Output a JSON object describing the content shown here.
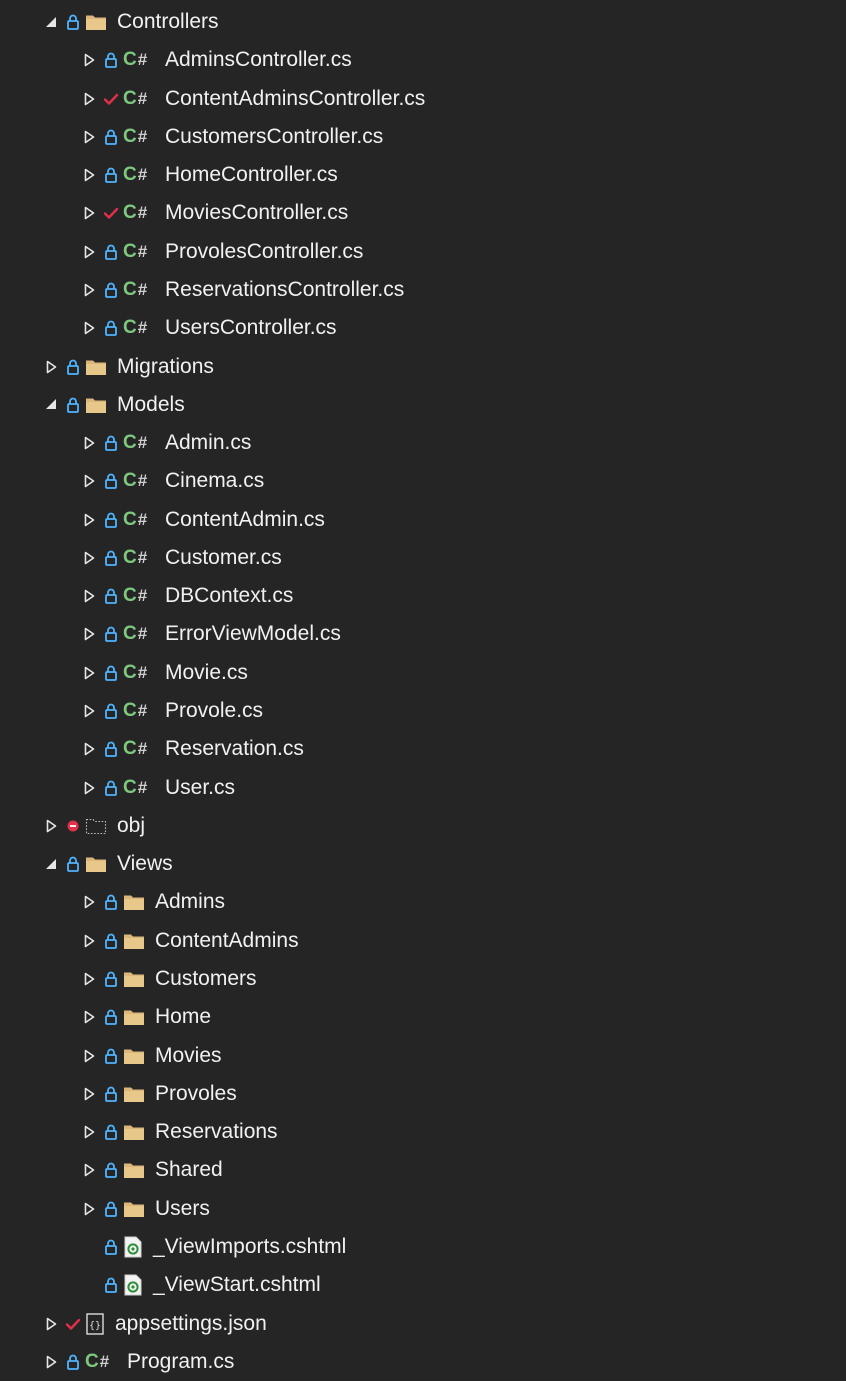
{
  "panel": "Solution Explorer",
  "colors": {
    "background": "#252526",
    "text": "#f1f1f1",
    "lock": "#4fb4ff",
    "check": "#e0304a",
    "error": "#e0304a",
    "folder": "#dcb67a",
    "csharp": "#7ec87e",
    "cshtml": "#7ec87e"
  },
  "tree": [
    {
      "label": "Controllers",
      "depth": 0,
      "expander": "expanded",
      "status": "lock",
      "type": "folder"
    },
    {
      "label": "AdminsController.cs",
      "depth": 1,
      "expander": "collapsed",
      "status": "lock",
      "type": "csharp"
    },
    {
      "label": "ContentAdminsController.cs",
      "depth": 1,
      "expander": "collapsed",
      "status": "check",
      "type": "csharp"
    },
    {
      "label": "CustomersController.cs",
      "depth": 1,
      "expander": "collapsed",
      "status": "lock",
      "type": "csharp"
    },
    {
      "label": "HomeController.cs",
      "depth": 1,
      "expander": "collapsed",
      "status": "lock",
      "type": "csharp"
    },
    {
      "label": "MoviesController.cs",
      "depth": 1,
      "expander": "collapsed",
      "status": "check",
      "type": "csharp"
    },
    {
      "label": "ProvolesController.cs",
      "depth": 1,
      "expander": "collapsed",
      "status": "lock",
      "type": "csharp"
    },
    {
      "label": "ReservationsController.cs",
      "depth": 1,
      "expander": "collapsed",
      "status": "lock",
      "type": "csharp"
    },
    {
      "label": "UsersController.cs",
      "depth": 1,
      "expander": "collapsed",
      "status": "lock",
      "type": "csharp"
    },
    {
      "label": "Migrations",
      "depth": 0,
      "expander": "collapsed",
      "status": "lock",
      "type": "folder"
    },
    {
      "label": "Models",
      "depth": 0,
      "expander": "expanded",
      "status": "lock",
      "type": "folder"
    },
    {
      "label": "Admin.cs",
      "depth": 1,
      "expander": "collapsed",
      "status": "lock",
      "type": "csharp"
    },
    {
      "label": "Cinema.cs",
      "depth": 1,
      "expander": "collapsed",
      "status": "lock",
      "type": "csharp"
    },
    {
      "label": "ContentAdmin.cs",
      "depth": 1,
      "expander": "collapsed",
      "status": "lock",
      "type": "csharp"
    },
    {
      "label": "Customer.cs",
      "depth": 1,
      "expander": "collapsed",
      "status": "lock",
      "type": "csharp"
    },
    {
      "label": "DBContext.cs",
      "depth": 1,
      "expander": "collapsed",
      "status": "lock",
      "type": "csharp"
    },
    {
      "label": "ErrorViewModel.cs",
      "depth": 1,
      "expander": "collapsed",
      "status": "lock",
      "type": "csharp"
    },
    {
      "label": "Movie.cs",
      "depth": 1,
      "expander": "collapsed",
      "status": "lock",
      "type": "csharp"
    },
    {
      "label": "Provole.cs",
      "depth": 1,
      "expander": "collapsed",
      "status": "lock",
      "type": "csharp"
    },
    {
      "label": "Reservation.cs",
      "depth": 1,
      "expander": "collapsed",
      "status": "lock",
      "type": "csharp"
    },
    {
      "label": "User.cs",
      "depth": 1,
      "expander": "collapsed",
      "status": "lock",
      "type": "csharp"
    },
    {
      "label": "obj",
      "depth": 0,
      "expander": "collapsed",
      "status": "error",
      "type": "objfolder"
    },
    {
      "label": "Views",
      "depth": 0,
      "expander": "expanded",
      "status": "lock",
      "type": "folder"
    },
    {
      "label": "Admins",
      "depth": 1,
      "expander": "collapsed",
      "status": "lock",
      "type": "folder"
    },
    {
      "label": "ContentAdmins",
      "depth": 1,
      "expander": "collapsed",
      "status": "lock",
      "type": "folder"
    },
    {
      "label": "Customers",
      "depth": 1,
      "expander": "collapsed",
      "status": "lock",
      "type": "folder"
    },
    {
      "label": "Home",
      "depth": 1,
      "expander": "collapsed",
      "status": "lock",
      "type": "folder"
    },
    {
      "label": "Movies",
      "depth": 1,
      "expander": "collapsed",
      "status": "lock",
      "type": "folder"
    },
    {
      "label": "Provoles",
      "depth": 1,
      "expander": "collapsed",
      "status": "lock",
      "type": "folder"
    },
    {
      "label": "Reservations",
      "depth": 1,
      "expander": "collapsed",
      "status": "lock",
      "type": "folder"
    },
    {
      "label": "Shared",
      "depth": 1,
      "expander": "collapsed",
      "status": "lock",
      "type": "folder"
    },
    {
      "label": "Users",
      "depth": 1,
      "expander": "collapsed",
      "status": "lock",
      "type": "folder"
    },
    {
      "label": "_ViewImports.cshtml",
      "depth": 1,
      "expander": "none",
      "status": "lock",
      "type": "cshtml"
    },
    {
      "label": "_ViewStart.cshtml",
      "depth": 1,
      "expander": "none",
      "status": "lock",
      "type": "cshtml"
    },
    {
      "label": "appsettings.json",
      "depth": 0,
      "expander": "collapsed",
      "status": "check",
      "type": "json"
    },
    {
      "label": "Program.cs",
      "depth": 0,
      "expander": "collapsed",
      "status": "lock",
      "type": "csharp"
    }
  ]
}
